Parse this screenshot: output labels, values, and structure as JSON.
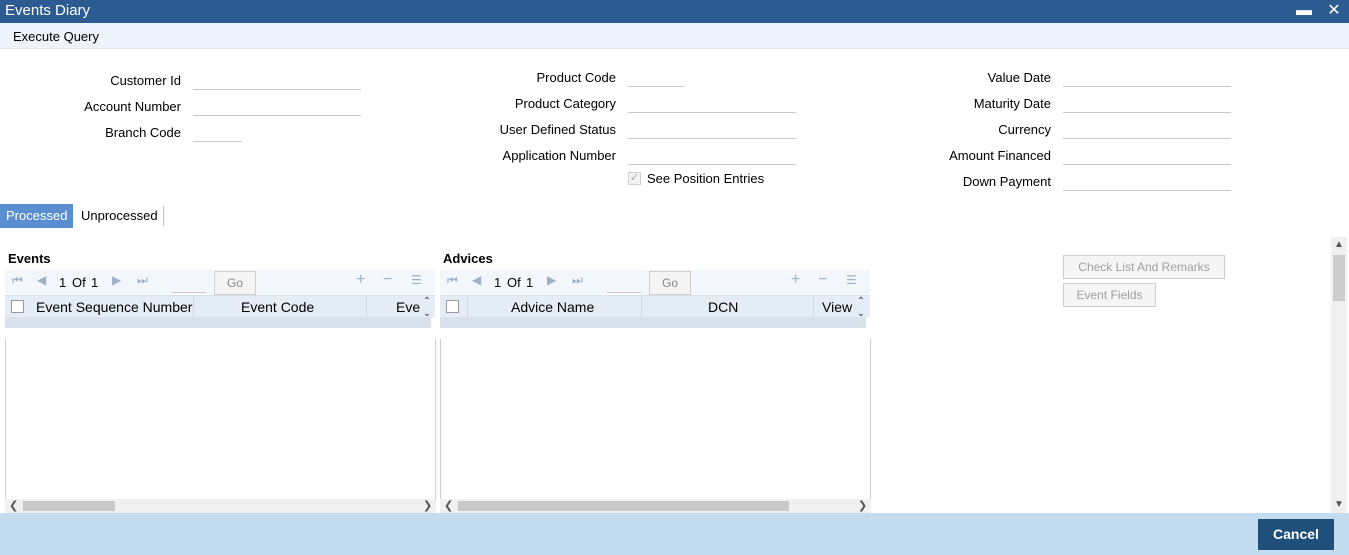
{
  "window": {
    "title": "Events Diary",
    "minimize": "▬",
    "close": "✕"
  },
  "menu": {
    "execute_query": "Execute Query"
  },
  "form": {
    "customer_id": "Customer Id",
    "account_number": "Account Number",
    "branch_code": "Branch Code",
    "product_code": "Product Code",
    "product_category": "Product Category",
    "user_defined_status": "User Defined Status",
    "application_number": "Application Number",
    "see_position_entries": "See Position Entries",
    "value_date": "Value Date",
    "maturity_date": "Maturity Date",
    "currency": "Currency",
    "amount_financed": "Amount Financed",
    "down_payment": "Down Payment"
  },
  "tabs": [
    {
      "label": "Processed"
    },
    {
      "label": "Unprocessed"
    }
  ],
  "events": {
    "title": "Events",
    "page_current": "1",
    "page_of": "Of",
    "page_total": "1",
    "go": "Go",
    "columns": [
      "Event Sequence Number",
      "Event Code",
      "Eve"
    ]
  },
  "advices": {
    "title": "Advices",
    "page_current": "1",
    "page_of": "Of",
    "page_total": "1",
    "go": "Go",
    "columns": [
      "Advice Name",
      "DCN",
      "View"
    ]
  },
  "side_buttons": {
    "checklist": "Check List And Remarks",
    "event_fields": "Event Fields"
  },
  "footer": {
    "cancel": "Cancel"
  }
}
